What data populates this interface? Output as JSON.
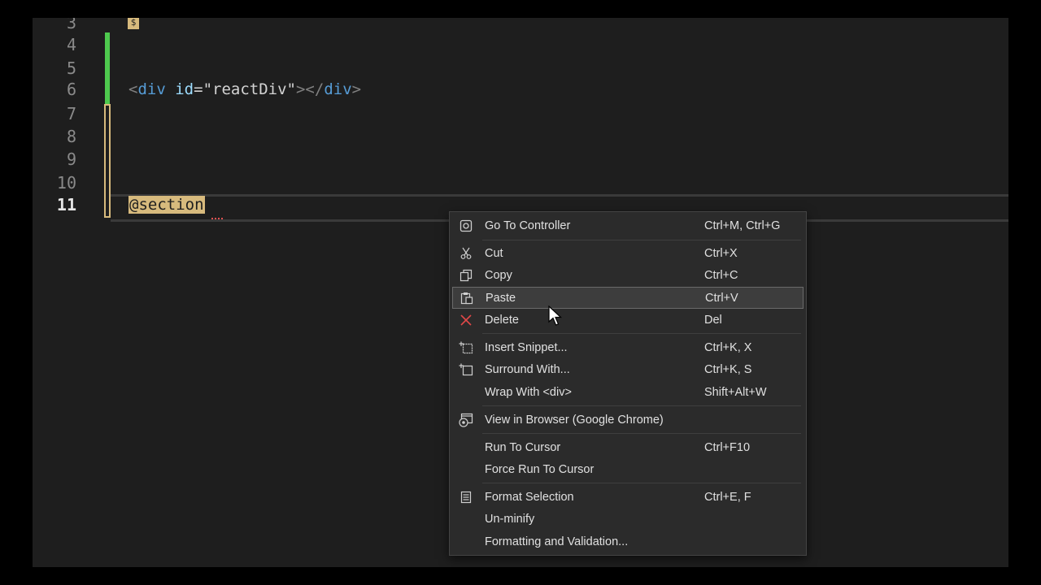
{
  "editor": {
    "line_numbers": [
      "3",
      "4",
      "5",
      "6",
      "7",
      "8",
      "9",
      "10",
      "11"
    ],
    "active_line": "11",
    "code_line6": {
      "open_lt": "<",
      "tag": "div",
      "attr": "id",
      "eq": "=",
      "val": "\"reactDiv\"",
      "close_gt": ">",
      "close_open": "</",
      "close_tag": "div",
      "close_end": ">"
    },
    "code_line11": "@section",
    "fold_glyph": "$",
    "colors": {
      "background": "#1e1e1e",
      "changed_bar": "#4ec94e",
      "unsaved_bar": "#d7ba7d"
    }
  },
  "context_menu": {
    "items": [
      {
        "icon": "controller-icon",
        "label": "Go To Controller",
        "shortcut": "Ctrl+M, Ctrl+G"
      },
      {
        "icon": "cut-icon",
        "label": "Cut",
        "shortcut": "Ctrl+X"
      },
      {
        "icon": "copy-icon",
        "label": "Copy",
        "shortcut": "Ctrl+C"
      },
      {
        "icon": "paste-icon",
        "label": "Paste",
        "shortcut": "Ctrl+V"
      },
      {
        "icon": "delete-icon",
        "label": "Delete",
        "shortcut": "Del"
      },
      {
        "icon": "insert-snippet-icon",
        "label": "Insert Snippet...",
        "shortcut": "Ctrl+K, X"
      },
      {
        "icon": "surround-with-icon",
        "label": "Surround With...",
        "shortcut": "Ctrl+K, S"
      },
      {
        "icon": "",
        "label": "Wrap With <div>",
        "shortcut": "Shift+Alt+W"
      },
      {
        "icon": "browser-icon",
        "label": "View in Browser (Google Chrome)",
        "shortcut": ""
      },
      {
        "icon": "",
        "label": "Run To Cursor",
        "shortcut": "Ctrl+F10"
      },
      {
        "icon": "",
        "label": "Force Run To Cursor",
        "shortcut": ""
      },
      {
        "icon": "format-selection-icon",
        "label": "Format Selection",
        "shortcut": "Ctrl+E, F"
      },
      {
        "icon": "",
        "label": "Un-minify",
        "shortcut": ""
      },
      {
        "icon": "",
        "label": "Formatting and Validation...",
        "shortcut": ""
      }
    ],
    "highlighted": "Paste"
  }
}
